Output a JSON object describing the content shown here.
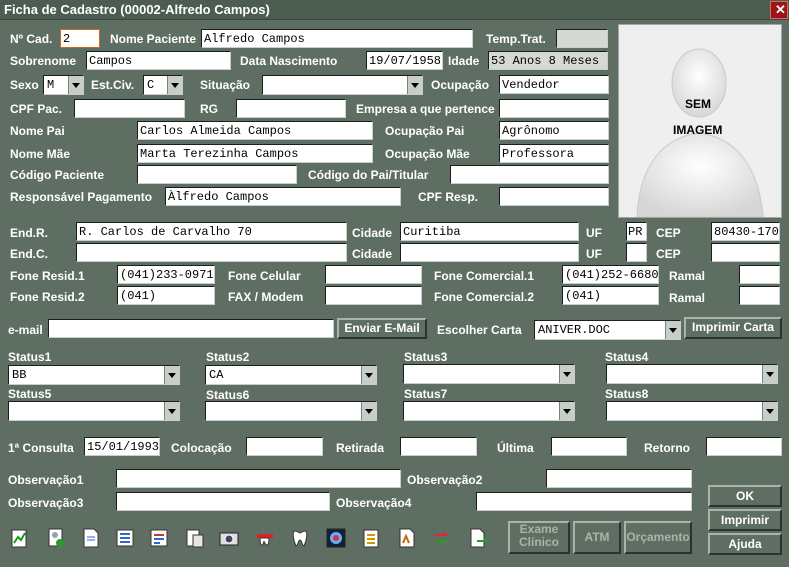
{
  "window": {
    "title": "Ficha de Cadastro (00002-Alfredo Campos)"
  },
  "form": {
    "n_cad": {
      "label": "Nº Cad.",
      "value": "2"
    },
    "nome_paciente": {
      "label": "Nome Paciente",
      "value": "Alfredo Campos"
    },
    "temp_trat": {
      "label": "Temp.Trat.",
      "value": ""
    },
    "sobrenome": {
      "label": "Sobrenome",
      "value": "Campos"
    },
    "data_nascimento": {
      "label": "Data Nascimento",
      "value": "19/07/1958"
    },
    "idade": {
      "label": "Idade",
      "value": "53 Anos 8 Meses"
    },
    "sexo": {
      "label": "Sexo",
      "value": "M"
    },
    "est_civ": {
      "label": "Est.Civ.",
      "value": "C"
    },
    "situacao": {
      "label": "Situação",
      "value": ""
    },
    "ocupacao": {
      "label": "Ocupação",
      "value": "Vendedor"
    },
    "cpf_pac": {
      "label": "CPF Pac.",
      "value": ""
    },
    "rg": {
      "label": "RG",
      "value": ""
    },
    "empresa": {
      "label": "Empresa a que pertence",
      "value": ""
    },
    "nome_pai": {
      "label": "Nome Pai",
      "value": "Carlos Almeida Campos"
    },
    "ocupacao_pai": {
      "label": "Ocupação Pai",
      "value": "Agrônomo"
    },
    "nome_mae": {
      "label": "Nome Mãe",
      "value": "Marta Terezinha Campos"
    },
    "ocupacao_mae": {
      "label": "Ocupação Mãe",
      "value": "Professora"
    },
    "codigo_paciente": {
      "label": "Código Paciente",
      "value": ""
    },
    "codigo_pai": {
      "label": "Código do Pai/Titular",
      "value": ""
    },
    "responsavel": {
      "label": "Responsável Pagamento",
      "value": "Àlfredo  Campos"
    },
    "cpf_resp": {
      "label": "CPF Resp.",
      "value": ""
    }
  },
  "photo": {
    "line1": "SEM",
    "line2": "IMAGEM"
  },
  "address": {
    "end_r": {
      "label": "End.R.",
      "value": "R. Carlos de Carvalho 70"
    },
    "cidade_r": {
      "label": "Cidade",
      "value": "Curitiba"
    },
    "uf_r": {
      "label": "UF",
      "value": "PR"
    },
    "cep_r": {
      "label": "CEP",
      "value": "80430-170"
    },
    "end_c": {
      "label": "End.C.",
      "value": ""
    },
    "cidade_c": {
      "label": "Cidade",
      "value": ""
    },
    "uf_c": {
      "label": "UF",
      "value": ""
    },
    "cep_c": {
      "label": "CEP",
      "value": ""
    }
  },
  "phones": {
    "fone_resid1": {
      "label": "Fone Resid.1",
      "value": "(041)233-0971"
    },
    "fone_celular": {
      "label": "Fone Celular",
      "value": ""
    },
    "fone_comercial1": {
      "label": "Fone Comercial.1",
      "value": "(041)252-6680"
    },
    "ramal1": {
      "label": "Ramal",
      "value": ""
    },
    "fone_resid2": {
      "label": "Fone Resid.2",
      "value": "(041)"
    },
    "fax": {
      "label": "FAX / Modem",
      "value": ""
    },
    "fone_comercial2": {
      "label": "Fone Comercial.2",
      "value": "(041)"
    },
    "ramal2": {
      "label": "Ramal",
      "value": ""
    }
  },
  "email": {
    "label": "e-mail",
    "value": "",
    "send_button": "Enviar E-Mail",
    "choose_label": "Escolher Carta",
    "carta_value": "ANIVER.DOC",
    "print_button": "Imprimir Carta"
  },
  "status": [
    {
      "label": "Status1",
      "value": "BB"
    },
    {
      "label": "Status2",
      "value": "CA"
    },
    {
      "label": "Status3",
      "value": ""
    },
    {
      "label": "Status4",
      "value": ""
    },
    {
      "label": "Status5",
      "value": ""
    },
    {
      "label": "Status6",
      "value": ""
    },
    {
      "label": "Status7",
      "value": ""
    },
    {
      "label": "Status8",
      "value": ""
    }
  ],
  "consulta": {
    "primeira": {
      "label": "1ª Consulta",
      "value": "15/01/1993"
    },
    "colocacao": {
      "label": "Colocação",
      "value": ""
    },
    "retirada": {
      "label": "Retirada",
      "value": ""
    },
    "ultima": {
      "label": "Última",
      "value": ""
    },
    "retorno": {
      "label": "Retorno",
      "value": ""
    }
  },
  "obs": {
    "obs1": {
      "label": "Observação1",
      "value": ""
    },
    "obs2": {
      "label": "Observação2",
      "value": ""
    },
    "obs3": {
      "label": "Observação3",
      "value": ""
    },
    "obs4": {
      "label": "Observação4",
      "value": ""
    }
  },
  "buttons": {
    "ok": "OK",
    "imprimir": "Imprimir",
    "ajuda": "Ajuda",
    "exame_l1": "Exame",
    "exame_l2": "Clínico",
    "atm": "ATM",
    "orcamento": "Orçamento"
  },
  "toolbar": [
    "chart-icon",
    "patient-check-icon",
    "document-icon",
    "list-icon",
    "form-icon",
    "report-icon",
    "camera-icon",
    "tooth-cap-icon",
    "tooth-icon",
    "xray-icon",
    "checklist-icon",
    "graph-icon",
    "transfer-icon",
    "export-icon"
  ]
}
